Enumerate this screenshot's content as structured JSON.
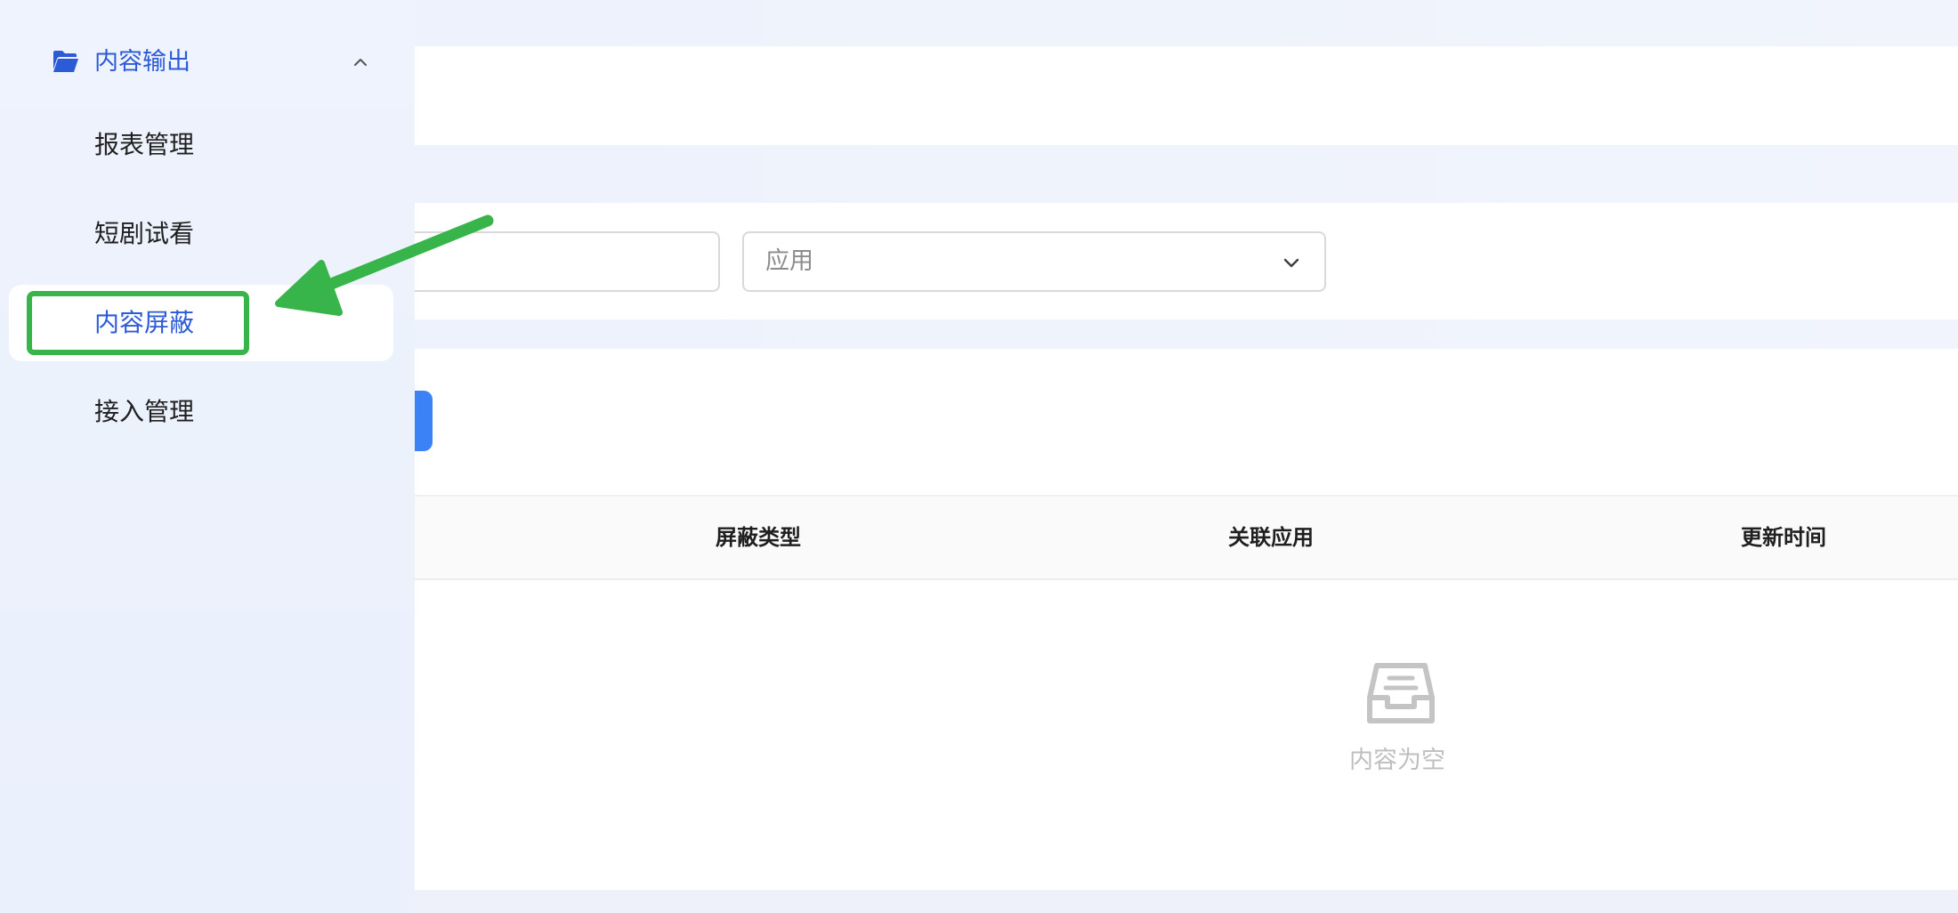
{
  "sidebar": {
    "group": {
      "label": "内容输出",
      "icon": "folder-open-icon",
      "expanded": true
    },
    "items": [
      {
        "label": "报表管理",
        "active": false
      },
      {
        "label": "短剧试看",
        "active": false
      },
      {
        "label": "内容屏蔽",
        "active": true
      },
      {
        "label": "接入管理",
        "active": false
      }
    ]
  },
  "filters": {
    "app_select": {
      "placeholder": "应用",
      "icon": "chevron-down-icon"
    }
  },
  "table": {
    "columns": [
      "屏蔽类型",
      "关联应用",
      "更新时间"
    ],
    "rows": [],
    "empty_text": "内容为空",
    "empty_icon": "inbox-icon"
  },
  "colors": {
    "accent": "#2d5bd8",
    "primary_button": "#3b82f6",
    "annotation": "#37b54a"
  }
}
